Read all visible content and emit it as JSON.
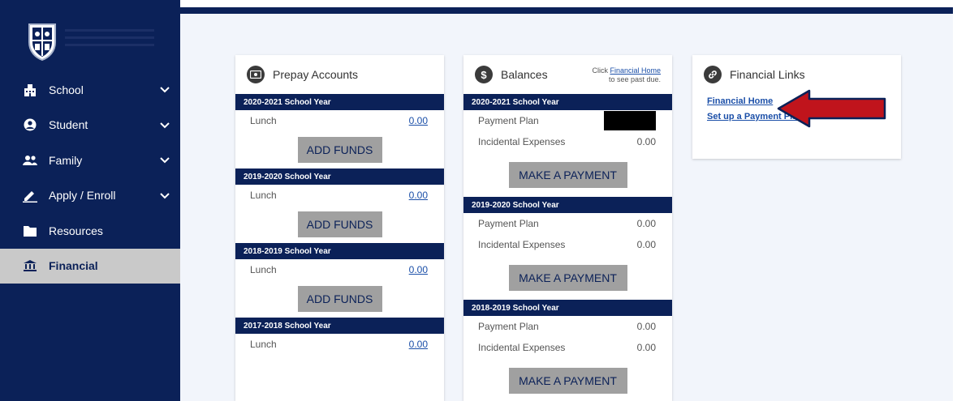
{
  "sidebar": {
    "items": [
      {
        "label": "School",
        "icon": "building-icon"
      },
      {
        "label": "Student",
        "icon": "person-icon"
      },
      {
        "label": "Family",
        "icon": "group-icon"
      },
      {
        "label": "Apply / Enroll",
        "icon": "pencil-icon"
      },
      {
        "label": "Resources",
        "icon": "folder-icon"
      },
      {
        "label": "Financial",
        "icon": "bank-icon",
        "active": true
      }
    ]
  },
  "prepay": {
    "title": "Prepay Accounts",
    "years": [
      {
        "label": "2020-2021 School Year",
        "item": "Lunch",
        "amount": "0.00",
        "button": "ADD FUNDS"
      },
      {
        "label": "2019-2020 School Year",
        "item": "Lunch",
        "amount": "0.00",
        "button": "ADD FUNDS"
      },
      {
        "label": "2018-2019 School Year",
        "item": "Lunch",
        "amount": "0.00",
        "button": "ADD FUNDS"
      },
      {
        "label": "2017-2018 School Year",
        "item": "Lunch",
        "amount": "0.00"
      }
    ]
  },
  "balances": {
    "title": "Balances",
    "hint_prefix": "Click ",
    "hint_link": "Financial Home",
    "hint_suffix": "to see past due.",
    "years": [
      {
        "label": "2020-2021 School Year",
        "payment_plan": "Payment Plan",
        "payment_amount": "",
        "incidental": "Incidental Expenses",
        "incidental_amount": "0.00",
        "button": "MAKE A PAYMENT"
      },
      {
        "label": "2019-2020 School Year",
        "payment_plan": "Payment Plan",
        "payment_amount": "0.00",
        "incidental": "Incidental Expenses",
        "incidental_amount": "0.00",
        "button": "MAKE A PAYMENT"
      },
      {
        "label": "2018-2019 School Year",
        "payment_plan": "Payment Plan",
        "payment_amount": "0.00",
        "incidental": "Incidental Expenses",
        "incidental_amount": "0.00",
        "button": "MAKE A PAYMENT"
      }
    ]
  },
  "links": {
    "title": "Financial Links",
    "items": [
      "Financial Home",
      "Set up a Payment Plan"
    ]
  },
  "colors": {
    "navy": "#0b2158",
    "arrow": "#c0141c",
    "link": "#1b4fa8",
    "button": "#a0a0a0"
  }
}
